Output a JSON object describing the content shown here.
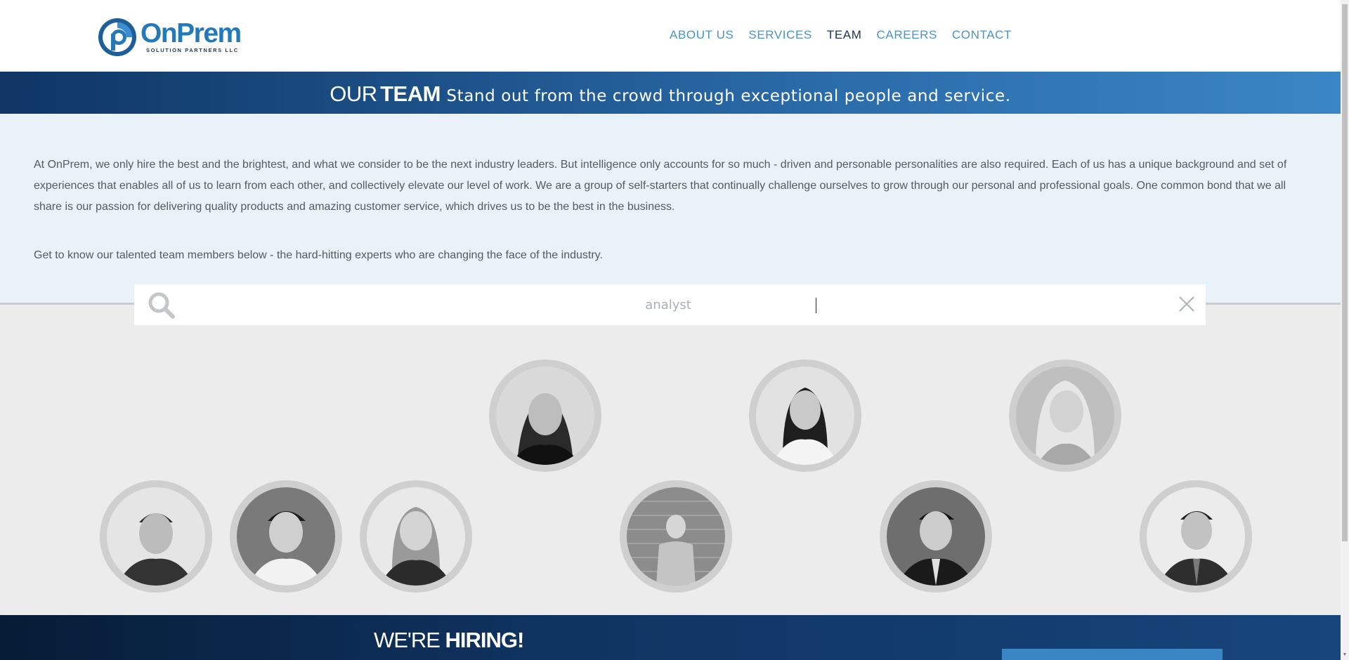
{
  "brand": {
    "name": "OnPrem",
    "tagline": "SOLUTION PARTNERS LLC",
    "color": "#2479b9"
  },
  "nav": {
    "items": [
      {
        "label": "ABOUT US",
        "active": false
      },
      {
        "label": "SERVICES",
        "active": false
      },
      {
        "label": "TEAM",
        "active": true
      },
      {
        "label": "CAREERS",
        "active": false
      },
      {
        "label": "CONTACT",
        "active": false
      }
    ]
  },
  "banner": {
    "our": "OUR",
    "team": "TEAM",
    "tagline": "Stand out from the crowd through exceptional people and service."
  },
  "intro": {
    "paragraph1": "At OnPrem, we only hire the best and the brightest, and what we consider to be the next industry leaders. But intelligence only accounts for so much - driven and personable personalities are also required. Each of us has a unique background and set of experiences that enables all of us to learn from each other, and collectively elevate our level of work. We are a group of self-starters that continually challenge ourselves to grow through our personal and professional goals. One common bond that we all share is our passion for delivering quality products and amazing customer service, which drives us to be the best in the business.",
    "paragraph2": "Get to know our talented team members below - the hard-hitting experts who are changing the face of the industry."
  },
  "search": {
    "value": "analyst",
    "icon": "search-icon",
    "clear_icon": "close-icon"
  },
  "team": {
    "member_count": 9,
    "photo_style": "grayscale-circle"
  },
  "hiring": {
    "prefix": "WE'RE",
    "bold": "HIRING!"
  },
  "colors": {
    "accent": "#4a93c9",
    "nav_active": "#1b3550",
    "banner_start": "#0f3564",
    "banner_end": "#3b86c6",
    "intro_bg": "#e9f1f9"
  }
}
